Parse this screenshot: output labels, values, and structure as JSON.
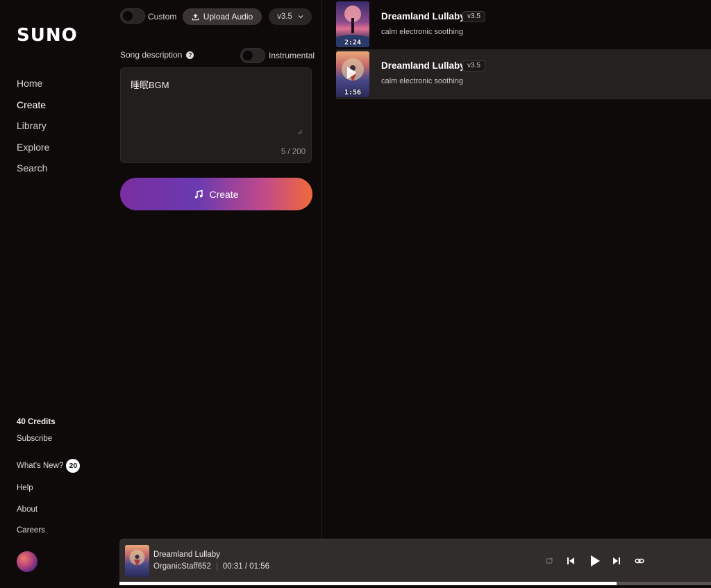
{
  "sidebar": {
    "logo": "SUNO",
    "nav": [
      "Home",
      "Create",
      "Library",
      "Explore",
      "Search"
    ],
    "credits": "40 Credits",
    "subscribe": "Subscribe",
    "whats_new": "What's New?",
    "whats_new_count": "20",
    "help": "Help",
    "about": "About",
    "careers": "Careers"
  },
  "create": {
    "custom_label": "Custom",
    "upload_label": "Upload Audio",
    "version": "v3.5",
    "song_description_label": "Song description",
    "instrumental_label": "Instrumental",
    "description_value": "睡眠BGM",
    "char_count": "5 / 200",
    "create_label": "Create"
  },
  "songs": [
    {
      "title": "Dreamland Lullaby",
      "version": "v3.5",
      "tags": "calm electronic soothing",
      "duration": "2:24"
    },
    {
      "title": "Dreamland Lullaby",
      "version": "v3.5",
      "tags": "calm electronic soothing",
      "duration": "1:56"
    }
  ],
  "player": {
    "title": "Dreamland Lullaby",
    "artist": "OrganicStaff652",
    "time": "00:31 / 01:56",
    "progress_percent": 84
  },
  "colors": {
    "background": "#0e0a0a",
    "panel": "#231e1e",
    "player": "#322d2d",
    "accent_start": "#7a2ea0",
    "accent_end": "#f06a3a"
  }
}
